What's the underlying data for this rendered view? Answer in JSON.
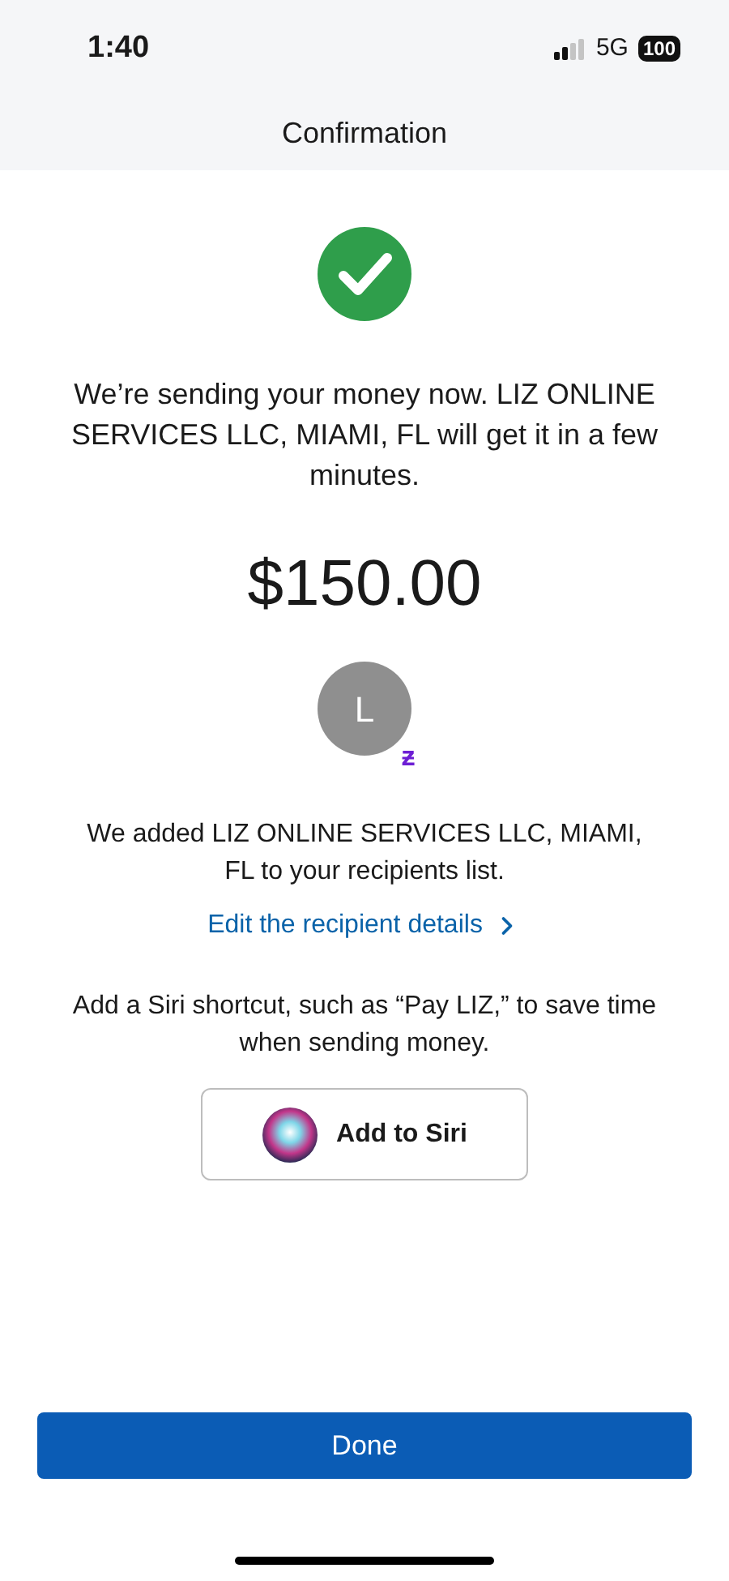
{
  "status_bar": {
    "time": "1:40",
    "network": "5G",
    "battery": "100"
  },
  "header": {
    "title": "Confirmation"
  },
  "message": "We’re sending your money now. LIZ ONLINE SERVICES LLC, MIAMI, FL will get it in a few minutes.",
  "amount": "$150.00",
  "recipient": {
    "initial": "L",
    "badge": "ƶ"
  },
  "added_note": "We added LIZ ONLINE SERVICES LLC, MIAMI, FL to your recipients list.",
  "edit_link": "Edit the recipient details",
  "siri_note": "Add a Siri shortcut, such as “Pay LIZ,” to save time when sending money.",
  "siri_button": "Add to Siri",
  "done_button": "Done"
}
